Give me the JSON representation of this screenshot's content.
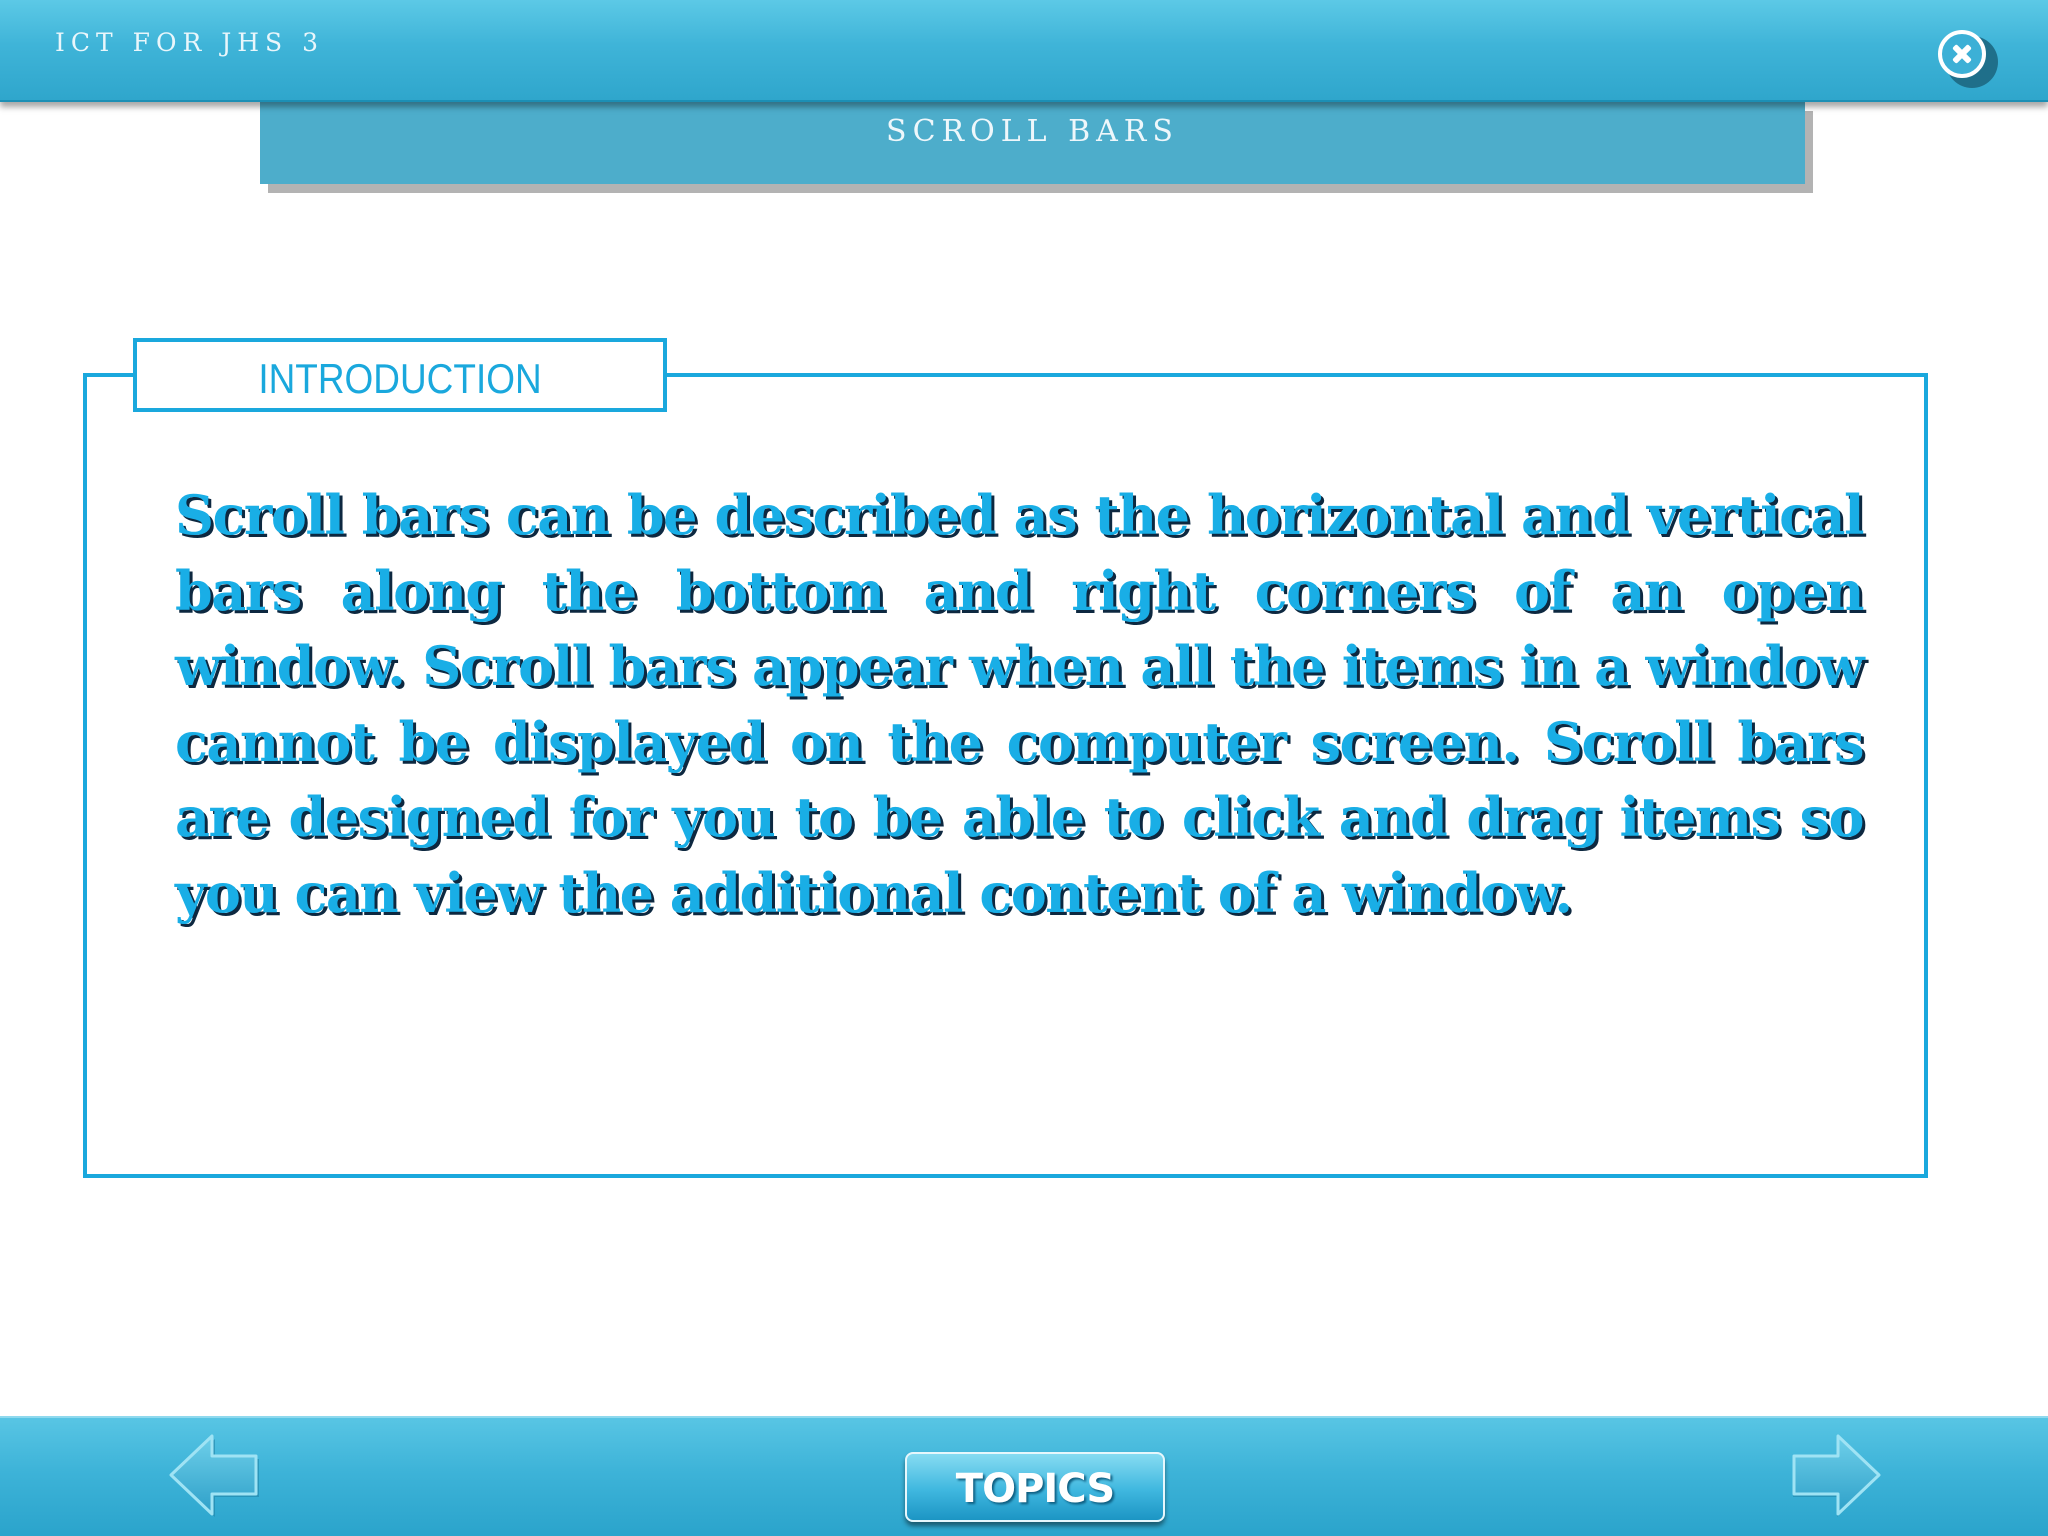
{
  "header": {
    "app_title": "ICT FOR JHS 3",
    "close_icon": "close-icon"
  },
  "section": {
    "title": "SCROLL BARS"
  },
  "content": {
    "tab_label": "INTRODUCTION",
    "body": "Scroll bars can be described as the horizontal and vertical bars along the bottom and right corners of an open window. Scroll bars appear when all the items in a window cannot be displayed on the computer screen. Scroll bars are designed for you to be able to click and drag items so you can view the additional content of a window."
  },
  "footer": {
    "prev_icon": "arrow-left-icon",
    "next_icon": "arrow-right-icon",
    "topics_label": "TOPICS"
  },
  "colors": {
    "bar_blue": "#3fb4d8",
    "banner_blue": "#4dadcb",
    "accent_blue": "#1aa8dd",
    "text_blue": "#19aee6",
    "text_shadow": "#0d2840"
  }
}
